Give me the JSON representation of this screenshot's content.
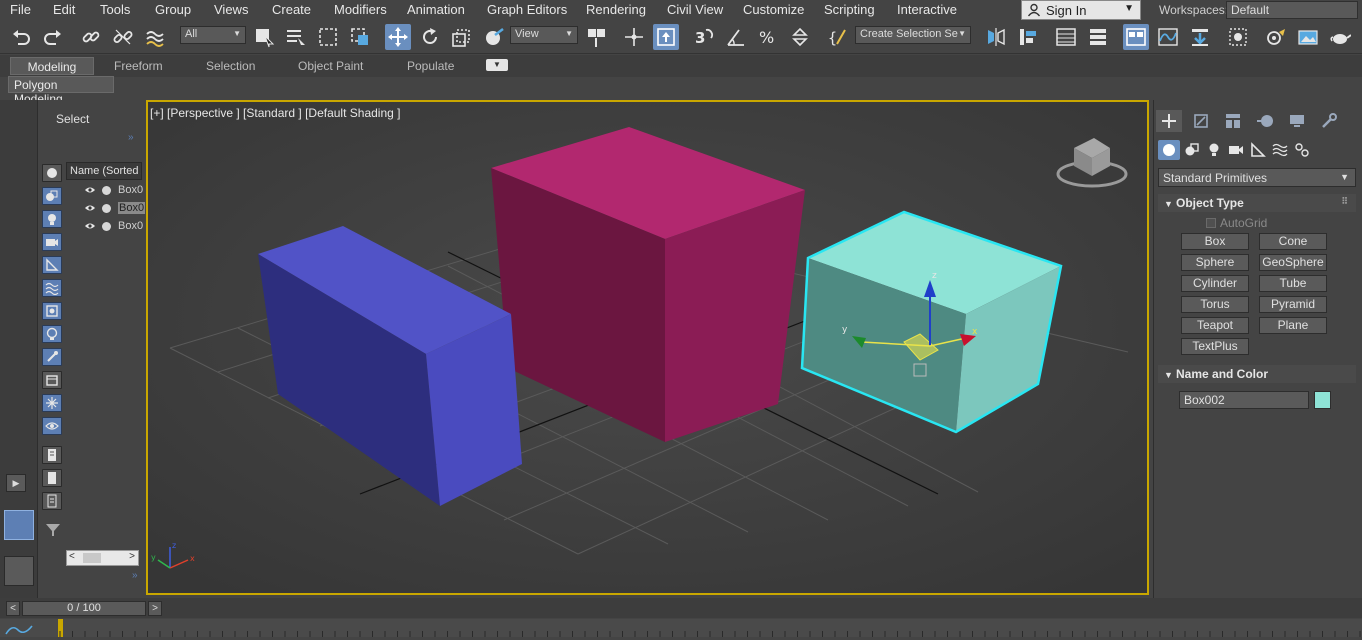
{
  "menubar": {
    "items": [
      "File",
      "Edit",
      "Tools",
      "Group",
      "Views",
      "Create",
      "Modifiers",
      "Animation",
      "Graph Editors",
      "Rendering",
      "Civil View",
      "Customize",
      "Scripting",
      "Interactive"
    ],
    "sign_in": "Sign In",
    "workspaces_label": "Workspaces:",
    "workspace_value": "Default"
  },
  "toolbar": {
    "selection_filter": "All",
    "reference_coord": "View",
    "named_selection": "Create Selection Se"
  },
  "ribbon": {
    "tabs": [
      "Modeling",
      "Freeform",
      "Selection",
      "Object Paint",
      "Populate"
    ],
    "active_tab": "Modeling",
    "subtab": "Polygon Modeling"
  },
  "explorer": {
    "select_label": "Select",
    "column_header": "Name (Sorted A",
    "rows": [
      "Box0",
      "Box0",
      "Box0"
    ]
  },
  "viewport": {
    "label": "[+] [Perspective ] [Standard ] [Default Shading ]",
    "gizmo_axes": {
      "x": "x",
      "y": "y",
      "z": "z"
    }
  },
  "command_panel": {
    "category_dropdown": "Standard Primitives",
    "object_type_title": "Object Type",
    "autogrid": "AutoGrid",
    "object_buttons": [
      "Box",
      "Cone",
      "Sphere",
      "GeoSphere",
      "Cylinder",
      "Tube",
      "Torus",
      "Pyramid",
      "Teapot",
      "Plane",
      "TextPlus"
    ],
    "name_color_title": "Name and Color",
    "object_name": "Box002",
    "object_color": "#8ee3d6"
  },
  "timeline": {
    "frame_display": "0 / 100"
  },
  "colors": {
    "accent": "#6a8fbf",
    "viewport_border": "#c9a700",
    "box_blue": "#4a4bbf",
    "box_magenta": "#b2286f",
    "box_cyan": "#8ee3d6",
    "selection_highlight": "#29e6f2"
  }
}
